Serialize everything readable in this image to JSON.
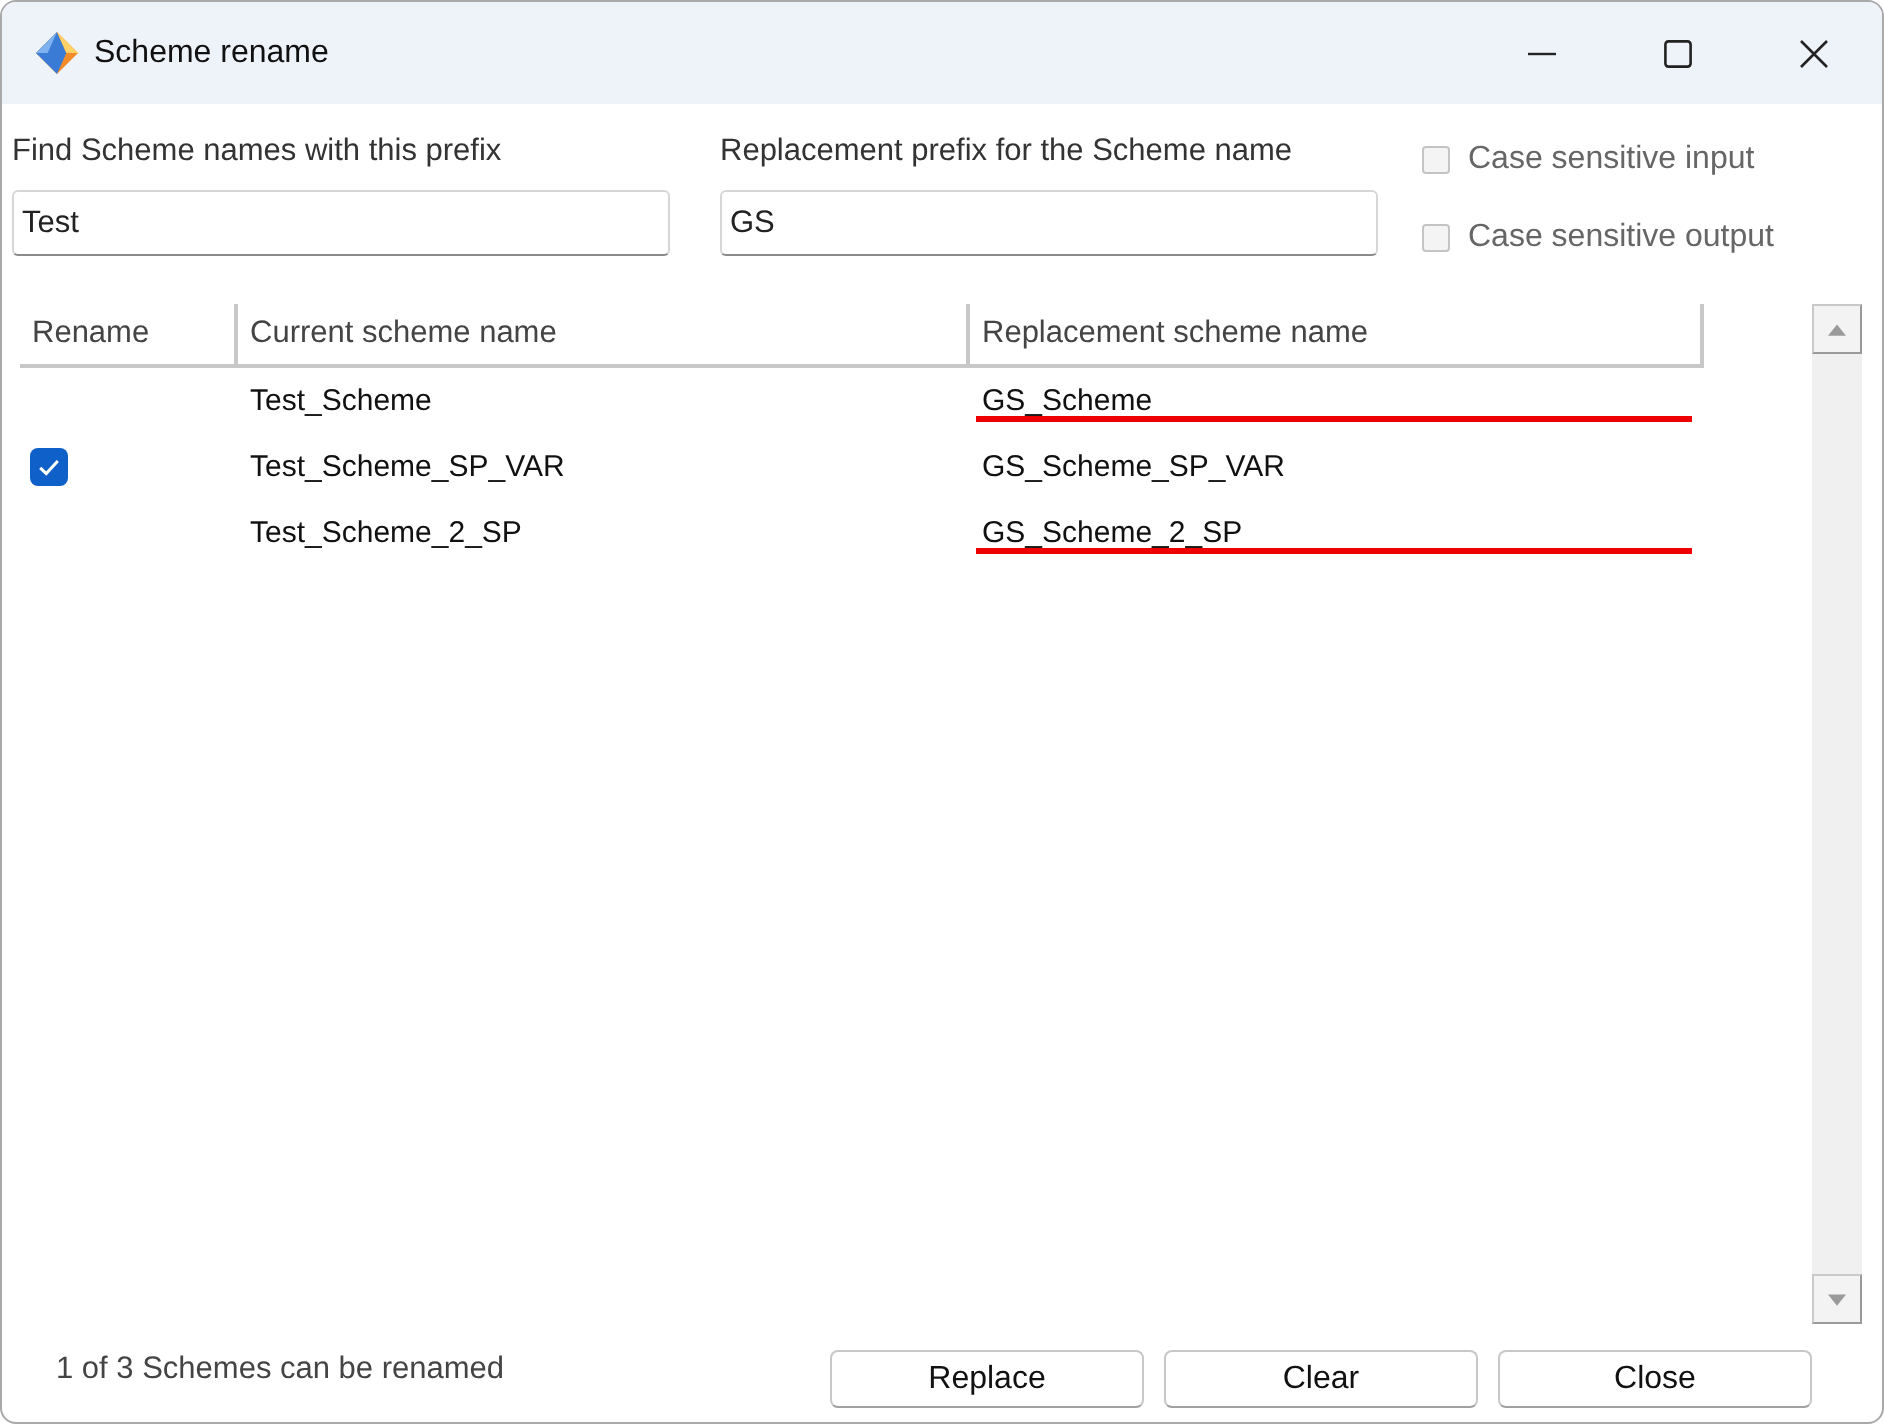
{
  "window": {
    "title": "Scheme rename"
  },
  "find_field": {
    "label": "Find Scheme names with this prefix",
    "value": "Test"
  },
  "replacement_field": {
    "label": "Replacement prefix for the Scheme name",
    "value": "GS"
  },
  "options": [
    {
      "label": "Case sensitive input",
      "checked": false
    },
    {
      "label": "Case sensitive output",
      "checked": false
    }
  ],
  "table": {
    "columns": [
      "Rename",
      "Current scheme name",
      "Replacement scheme name"
    ],
    "rows": [
      {
        "checked": false,
        "current": "Test_Scheme",
        "replacement": "GS_Scheme",
        "marked": true
      },
      {
        "checked": true,
        "current": "Test_Scheme_SP_VAR",
        "replacement": "GS_Scheme_SP_VAR",
        "marked": false
      },
      {
        "checked": false,
        "current": "Test_Scheme_2_SP",
        "replacement": "GS_Scheme_2_SP",
        "marked": true
      }
    ]
  },
  "status": "1 of 3 Schemes can be renamed",
  "buttons": [
    "Replace",
    "Clear",
    "Close"
  ]
}
